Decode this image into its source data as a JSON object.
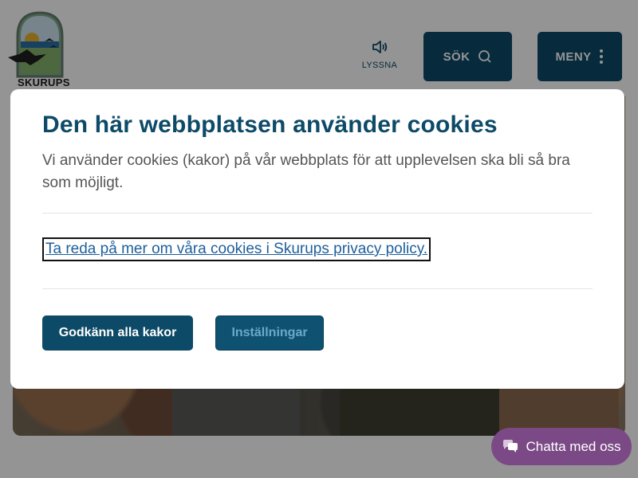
{
  "header": {
    "logo_text": "SKURUPS",
    "listen_label": "LYSSNA",
    "search_label": "SÖK",
    "menu_label": "MENY"
  },
  "cookie_modal": {
    "title": "Den här webbplatsen använder cookies",
    "description": "Vi använder cookies (kakor) på vår webbplats för att upplevelsen ska bli så bra som möjligt.",
    "policy_link": "Ta reda på mer om våra cookies i Skurups privacy policy.",
    "accept_label": "Godkänn alla kakor",
    "settings_label": "Inställningar"
  },
  "chat": {
    "label": "Chatta med oss"
  },
  "colors": {
    "primary": "#0d4a68",
    "chat": "#7b4a86",
    "link": "#1d5f9b"
  }
}
